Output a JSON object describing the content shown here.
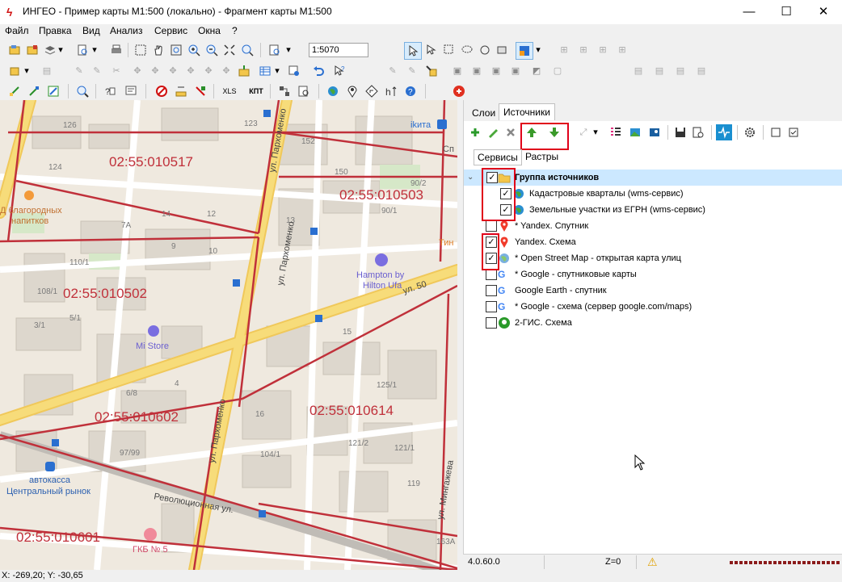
{
  "window": {
    "title": "ИНГЕО - Пример карты М1:500 (локально) - Фрагмент карты М1:500",
    "app_icon": "ingeo-icon",
    "controls": {
      "minimize": "—",
      "maximize": "☐",
      "close": "✕"
    }
  },
  "menu": [
    "Файл",
    "Правка",
    "Вид",
    "Анализ",
    "Сервис",
    "Окна",
    "?"
  ],
  "toolbar": {
    "scale_value": "1:5070",
    "xls_label": "XLS",
    "kpt_label": "КПТ"
  },
  "map": {
    "cadastral_labels": [
      "02:55:010517",
      "02:55:010503",
      "02:55:010502",
      "02:55:010602",
      "02:55:010614",
      "02:55:010601"
    ],
    "house_numbers": [
      "126",
      "123",
      "152",
      "124",
      "150",
      "90/2",
      "14",
      "12",
      "13",
      "7A",
      "9",
      "10",
      "110/1",
      "108/1",
      "3/1",
      "5/1",
      "97/99",
      "6/8",
      "4",
      "104/1",
      "125/1",
      "121/2",
      "121/1",
      "119",
      "163A",
      "15",
      "16",
      "90/1"
    ],
    "streets": [
      "ул. Пархоменко",
      "ул. Пархоменко",
      "ул. Пархоменко",
      "Революционная ул.",
      "ул. 50",
      "ул. Мингажева"
    ],
    "pois": {
      "ikita": "ikита",
      "sp": "Сп",
      "tin": "Тин",
      "blag": "Д благородных",
      "napitkov": "напитков",
      "hampton1": "Hampton by",
      "hampton2": "Hilton Ufa",
      "mistore": "Mi Store",
      "avtokassa": "автокасса",
      "rynok": "Центральный рынок",
      "gkb": "ГКБ № 5"
    }
  },
  "panel": {
    "tabs": [
      "Слои",
      "Источники"
    ],
    "active_tab": "Источники",
    "subtabs": [
      "Сервисы",
      "Растры"
    ],
    "sources": [
      {
        "label": "Группа источников",
        "checked": "✓",
        "icon": "folder-icon",
        "group": true
      },
      {
        "label": "Кадастровые кварталы (wms-сервис)",
        "checked": "✓",
        "icon": "globe-icon"
      },
      {
        "label": "Земельные участки из ЕГРН (wms-сервис)",
        "checked": "✓",
        "icon": "globe-icon"
      },
      {
        "label": "* Yandex. Спутник",
        "checked": "",
        "icon": "yandex-pin-icon"
      },
      {
        "label": "Yandex. Схема",
        "checked": "✓",
        "icon": "yandex-pin-icon"
      },
      {
        "label": "* Open Street Map - открытая карта улиц",
        "checked": "✓",
        "icon": "globe-icon"
      },
      {
        "label": "* Google - спутниковые карты",
        "checked": "",
        "icon": "google-icon"
      },
      {
        "label": "Google Earth - спутник",
        "checked": "",
        "icon": "google-icon"
      },
      {
        "label": "* Google - схема (сервер google.com/maps)",
        "checked": "",
        "icon": "google-icon"
      },
      {
        "label": "2-ГИС. Схема",
        "checked": "",
        "icon": "2gis-icon"
      }
    ]
  },
  "status": {
    "version": "4.0.60.0",
    "z": "Z=0",
    "warning": "⚠"
  },
  "coords": "X: -269,20; Y: -30,65",
  "colors": {
    "accent_red": "#e0001a",
    "road_yellow": "#f7d65a",
    "cadastral": "#c0303a",
    "selection": "#cce8ff"
  }
}
